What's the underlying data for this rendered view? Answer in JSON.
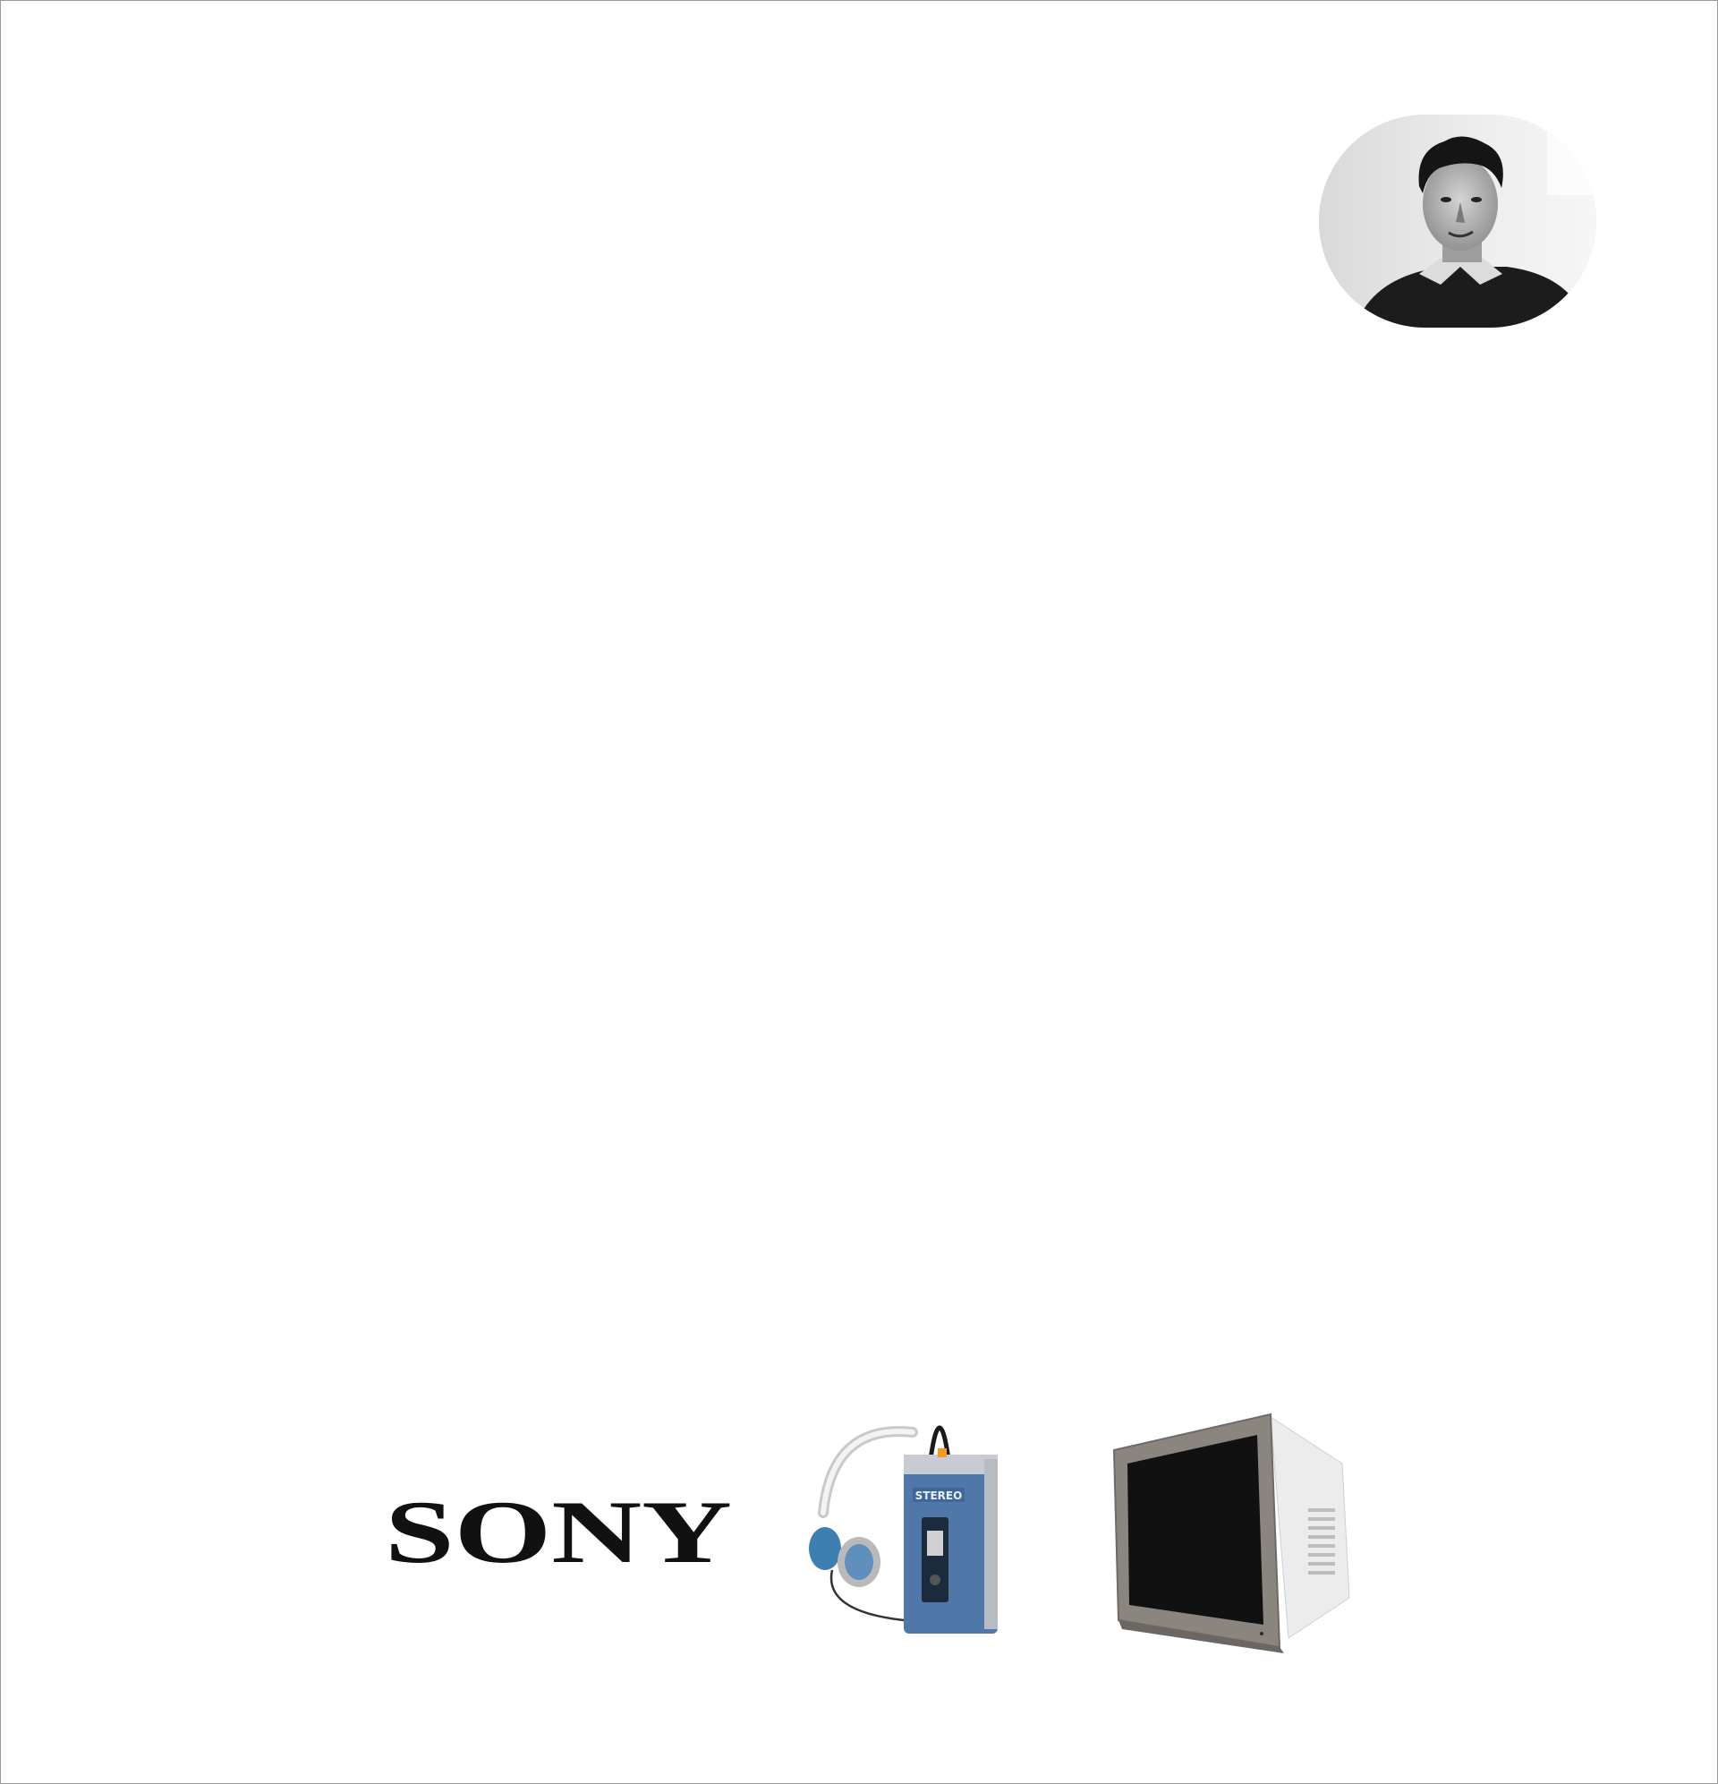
{
  "brand": {
    "logo_text": "SONY",
    "logo_color": "#111111"
  },
  "images": {
    "portrait": {
      "description_icon": "portrait-photo",
      "tone": "black-and-white"
    },
    "walkman": {
      "label_text": "STEREO",
      "body_color": "#4f78a8",
      "earpad_color": "#3c7fb0"
    },
    "monitor": {
      "frame_color": "#8b8580",
      "casing_color": "#ececec"
    }
  }
}
